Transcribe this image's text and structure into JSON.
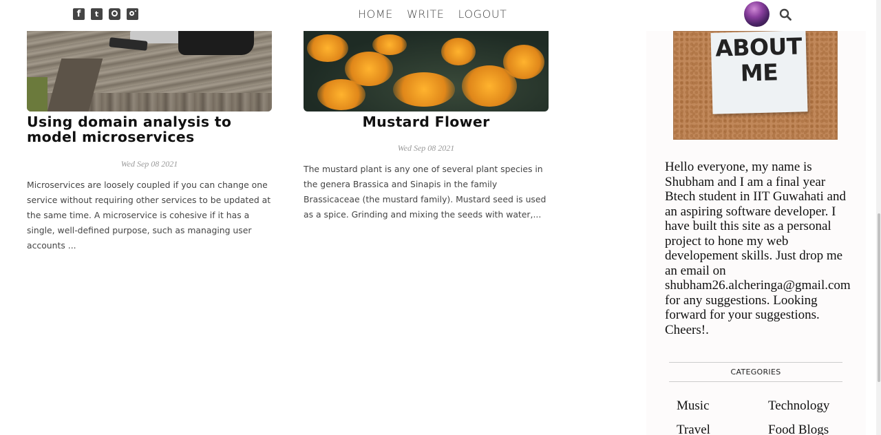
{
  "nav": {
    "social_icons": [
      "facebook-icon",
      "twitter-icon",
      "pinterest-icon",
      "instagram-icon"
    ],
    "links": [
      "HOME",
      "WRITE",
      "LOGOUT"
    ]
  },
  "posts": [
    {
      "title": "Using domain analysis to model microservices",
      "date": "Wed Sep 08 2021",
      "excerpt": "Microservices are loosely coupled if you can change one service without requiring other services to be updated at the same time. A microservice is cohesive if it has a single, well-defined purpose, such as managing user accounts ..."
    },
    {
      "title": "Mustard Flower",
      "date": "Wed Sep 08 2021",
      "excerpt": "The mustard plant is any one of several plant species in the genera Brassica and Sinapis in the family Brassicaceae (the mustard family). Mustard seed is used as a spice. Grinding and mixing the seeds with water,..."
    }
  ],
  "sidebar": {
    "about_image_text": "ABOUT ME",
    "about_text": "Hello everyone, my name is Shubham and I am a final year Btech student in IIT Guwahati and an aspiring software developer. I have built this site as a personal project to hone my web developement skills. Just drop me an email on shubham26.alcheringa@gmail.com for any suggestions. Looking forward for your suggestions. Cheers!.",
    "categories_title": "CATEGORIES",
    "categories": [
      "Music",
      "Technology",
      "Travel",
      "Food Blogs"
    ]
  },
  "colors": {
    "nav_text": "#444444",
    "sidebar_bg": "#fdfbfb",
    "date_text": "#999999"
  }
}
